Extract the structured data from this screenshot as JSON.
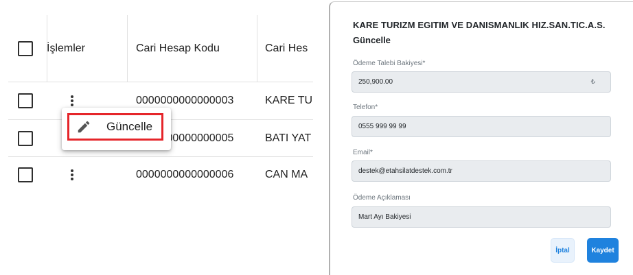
{
  "table": {
    "headers": {
      "ops": "İşlemler",
      "code": "Cari Hesap Kodu",
      "name": "Cari Hes"
    },
    "rows": [
      {
        "code": "0000000000000003",
        "name": "KARE TU"
      },
      {
        "code": "0000000000000005",
        "name": "BATI YAT"
      },
      {
        "code": "0000000000000006",
        "name": "CAN MA"
      }
    ]
  },
  "context_menu": {
    "update_label": "Güncelle",
    "icon": "pencil-icon"
  },
  "modal": {
    "title": "KARE TURIZM EGITIM VE DANISMANLIK HIZ.SAN.TIC.A.S.",
    "subtitle": "Güncelle",
    "fields": {
      "balance": {
        "label": "Ödeme Talebi Bakiyesi*",
        "value": "250,900.00",
        "currency": "₺"
      },
      "phone": {
        "label": "Telefon*",
        "value": "0555 999 99 99"
      },
      "email": {
        "label": "Email*",
        "value": "destek@etahsilatdestek.com.tr"
      },
      "description": {
        "label": "Ödeme Açıklaması",
        "value": "Mart Ayı Bakiyesi"
      }
    },
    "buttons": {
      "cancel": "İptal",
      "save": "Kaydet"
    }
  },
  "colors": {
    "highlight": "#e5252a",
    "primary": "#1f82de",
    "field_bg": "#e9ecef"
  }
}
